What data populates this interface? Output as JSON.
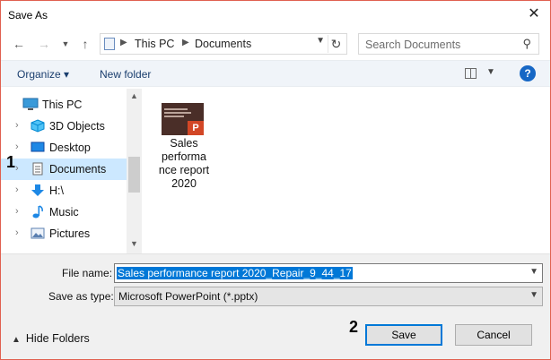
{
  "window": {
    "title": "Save As",
    "close_icon": "close-icon"
  },
  "nav": {
    "back_icon": "arrow-left-icon",
    "forward_icon": "arrow-right-icon",
    "recent_icon": "chevron-down-icon",
    "up_icon": "arrow-up-icon",
    "address": {
      "crumbs": [
        "This PC",
        "Documents"
      ]
    },
    "search": {
      "placeholder": "Search Documents"
    }
  },
  "toolbar": {
    "organize": "Organize ▾",
    "new_folder": "New folder"
  },
  "sidebar": {
    "items": [
      {
        "label": "This PC",
        "icon": "computer-icon"
      },
      {
        "label": "3D Objects",
        "icon": "cube-icon"
      },
      {
        "label": "Desktop",
        "icon": "desktop-icon"
      },
      {
        "label": "Documents",
        "icon": "documents-icon",
        "selected": true
      },
      {
        "label": "H:\\",
        "icon": "download-arrow-icon"
      },
      {
        "label": "Music",
        "icon": "music-note-icon"
      },
      {
        "label": "Pictures",
        "icon": "pictures-icon"
      }
    ]
  },
  "files": [
    {
      "name": "Sales performance report 2020",
      "lines": [
        "Sales",
        "performa",
        "nce report",
        "2020"
      ],
      "icon": "powerpoint-file-icon"
    }
  ],
  "form": {
    "file_name_label": "File name:",
    "file_name_value": "Sales performance report 2020_Repair_9_44_17",
    "save_type_label": "Save as type:",
    "save_type_value": "Microsoft PowerPoint (*.pptx)"
  },
  "footer": {
    "hide_folders": "Hide Folders",
    "save": "Save",
    "cancel": "Cancel"
  },
  "annotations": {
    "marker1": "1",
    "marker2": "2"
  }
}
